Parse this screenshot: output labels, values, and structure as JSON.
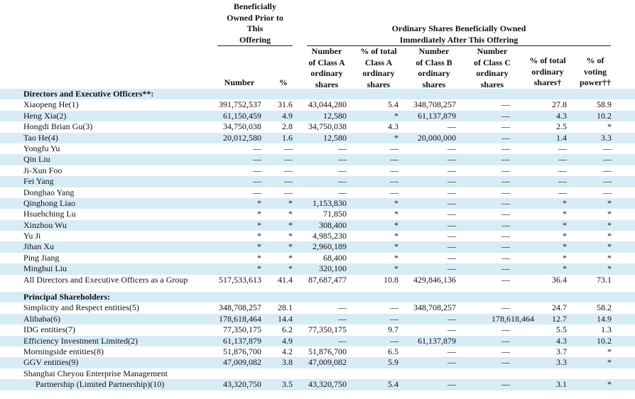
{
  "header": {
    "group1": [
      "Beneficially",
      "Owned Prior to",
      "This",
      "Offering"
    ],
    "group2": [
      "Ordinary Shares Beneficially Owned",
      "Immediately After This Offering"
    ],
    "columns": [
      [
        "Number"
      ],
      [
        "%"
      ],
      [
        "Number",
        "of Class A",
        "ordinary",
        "shares"
      ],
      [
        "% of total",
        "Class A",
        "ordinary",
        "shares"
      ],
      [
        "Number",
        "of Class B",
        "ordinary",
        "shares"
      ],
      [
        "Number",
        "of Class C",
        "ordinary",
        "shares"
      ],
      [
        "% of total",
        "ordinary",
        "shares†"
      ],
      [
        "% of",
        "voting",
        "power††"
      ]
    ]
  },
  "rows": [
    {
      "type": "section",
      "name": "Directors and Executive Officers**:",
      "cells": [
        "",
        "",
        "",
        "",
        "",
        "",
        "",
        ""
      ]
    },
    {
      "type": "data",
      "name": "Xiaopeng He(1)",
      "cells": [
        "391,752,537",
        "31.6",
        "43,044,280",
        "5.4",
        "348,708,257",
        "—",
        "27.8",
        "58.9"
      ]
    },
    {
      "type": "data",
      "name": "Heng Xia(2)",
      "cells": [
        "61,150,459",
        "4.9",
        "12,580",
        "*",
        "61,137,879",
        "—",
        "4.3",
        "10.2"
      ]
    },
    {
      "type": "data",
      "name": "Hongdi Brian Gu(3)",
      "cells": [
        "34,750,038",
        "2.8",
        "34,750,038",
        "4.3",
        "—",
        "—",
        "2.5",
        "*"
      ]
    },
    {
      "type": "data",
      "name": "Tao He(4)",
      "cells": [
        "20,012,580",
        "1.6",
        "12,580",
        "*",
        "20,000,000",
        "—",
        "1.4",
        "3.3"
      ]
    },
    {
      "type": "data",
      "name": "Yongfu Yu",
      "cells": [
        "—",
        "—",
        "—",
        "—",
        "—",
        "—",
        "—",
        "—"
      ]
    },
    {
      "type": "data",
      "name": "Qin Liu",
      "cells": [
        "—",
        "—",
        "—",
        "—",
        "—",
        "—",
        "—",
        "—"
      ]
    },
    {
      "type": "data",
      "name": "Ji-Xun Foo",
      "cells": [
        "—",
        "—",
        "—",
        "—",
        "—",
        "—",
        "—",
        "—"
      ]
    },
    {
      "type": "data",
      "name": "Fei Yang",
      "cells": [
        "—",
        "—",
        "—",
        "—",
        "—",
        "—",
        "—",
        "—"
      ]
    },
    {
      "type": "data",
      "name": "Donghao Yang",
      "cells": [
        "—",
        "—",
        "—",
        "—",
        "—",
        "—",
        "—",
        "—"
      ]
    },
    {
      "type": "data",
      "name": "Qinghong Liao",
      "cells": [
        "*",
        "*",
        "1,153,830",
        "*",
        "—",
        "—",
        "*",
        "*"
      ]
    },
    {
      "type": "data",
      "name": "Hsuehching Lu",
      "cells": [
        "*",
        "*",
        "71,850",
        "*",
        "—",
        "—",
        "*",
        "*"
      ]
    },
    {
      "type": "data",
      "name": "Xinzhou Wu",
      "cells": [
        "*",
        "*",
        "308,400",
        "*",
        "—",
        "—",
        "*",
        "*"
      ]
    },
    {
      "type": "data",
      "name": "Yu Ji",
      "cells": [
        "*",
        "*",
        "4,985,230",
        "*",
        "—",
        "—",
        "*",
        "*"
      ]
    },
    {
      "type": "data",
      "name": "Jihan Xu",
      "cells": [
        "*",
        "*",
        "2,960,189",
        "*",
        "—",
        "—",
        "*",
        "*"
      ]
    },
    {
      "type": "data",
      "name": "Ping Jiang",
      "cells": [
        "*",
        "*",
        "68,400",
        "*",
        "—",
        "—",
        "*",
        "*"
      ]
    },
    {
      "type": "data",
      "name": "Minghui Liu",
      "cells": [
        "*",
        "*",
        "320,100",
        "*",
        "—",
        "—",
        "*",
        "*"
      ]
    },
    {
      "type": "data",
      "name": "All Directors and Executive Officers as a Group",
      "cells": [
        "517,533,613",
        "41.4",
        "87,687,477",
        "10.8",
        "429,846,136",
        "—",
        "36.4",
        "73.1"
      ]
    },
    {
      "type": "spacer"
    },
    {
      "type": "section",
      "name": "Principal Shareholders:",
      "cells": [
        "",
        "",
        "",
        "",
        "",
        "",
        "",
        ""
      ]
    },
    {
      "type": "data",
      "name": "Simplicity and Respect entities(5)",
      "cells": [
        "348,708,257",
        "28.1",
        "—",
        "—",
        "348,708,257",
        "—",
        "24.7",
        "58.2"
      ]
    },
    {
      "type": "data",
      "name": "Alibaba(6)",
      "cells": [
        "178,618,464",
        "14.4",
        "—",
        "—",
        "—",
        "178,618,464",
        "12.7",
        "14.9"
      ]
    },
    {
      "type": "data",
      "name": "IDG entities(7)",
      "cells": [
        "77,350,175",
        "6.2",
        "77,350,175",
        "9.7",
        "—",
        "—",
        "5.5",
        "1.3"
      ]
    },
    {
      "type": "data",
      "name": "Efficiency Investment Limited(2)",
      "cells": [
        "61,137,879",
        "4.9",
        "—",
        "—",
        "61,137,879",
        "—",
        "4.3",
        "10.2"
      ]
    },
    {
      "type": "data",
      "name": "Morningside entities(8)",
      "cells": [
        "51,876,700",
        "4.2",
        "51,876,700",
        "6.5",
        "—",
        "—",
        "3.7",
        "*"
      ]
    },
    {
      "type": "data",
      "name": "GGV entities(9)",
      "cells": [
        "47,009,082",
        "3.8",
        "47,009,082",
        "5.9",
        "—",
        "—",
        "3.3",
        "*"
      ]
    },
    {
      "type": "data",
      "name": "Shanghai Cheyou Enterprise Management",
      "cells": [
        "",
        "",
        "",
        "",
        "",
        "",
        "",
        ""
      ]
    },
    {
      "type": "data",
      "name": "Partnership (Limited Partnership)(10)",
      "indent": true,
      "cells": [
        "43,320,750",
        "3.5",
        "43,320,750",
        "5.4",
        "—",
        "—",
        "3.1",
        "*"
      ]
    }
  ]
}
